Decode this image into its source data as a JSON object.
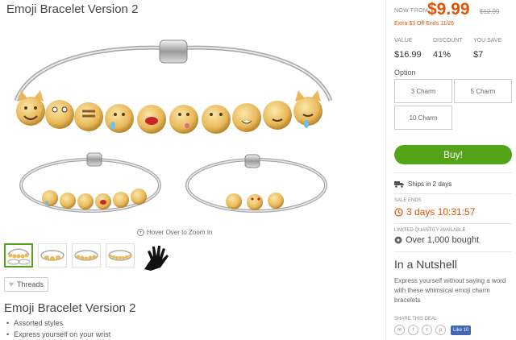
{
  "product": {
    "title": "Emoji Bracelet Version 2"
  },
  "image": {
    "zoom_hint": "Hover Over to Zoom In"
  },
  "threads": {
    "label": "Threads"
  },
  "description": {
    "title": "Emoji Bracelet Version 2",
    "bullets": [
      "Assorted styles",
      "Express yourself on your wrist"
    ]
  },
  "pricing": {
    "now_from": "NOW FROM",
    "price": "$9.99",
    "original": "$12.99",
    "extra": "Extra $3 Off Ends 11/26",
    "labels": [
      "VALUE",
      "DISCOUNT",
      "YOU SAVE"
    ],
    "values": [
      "$16.99",
      "41%",
      "$7"
    ]
  },
  "options": {
    "label": "Option",
    "items": [
      "3 Charm",
      "5 Charm",
      "10 Charm"
    ]
  },
  "buy": {
    "label": "Buy!"
  },
  "shipping": {
    "text": "Ships in 2 days"
  },
  "sale": {
    "label": "SALE ENDS",
    "timer": "3 days 10:31:57"
  },
  "limited": {
    "label": "LIMITED QUANTITY AVAILABLE",
    "bought": "Over 1,000 bought"
  },
  "nutshell": {
    "title": "In a Nutshell",
    "text": "Express yourself without saying a word with these whimsical emoji charm bracelets"
  },
  "share": {
    "label": "SHARE THIS DEAL",
    "like": "Like 10"
  },
  "colors": {
    "accent": "#e35205",
    "brand_green": "#53a318",
    "facebook": "#4267b2"
  }
}
